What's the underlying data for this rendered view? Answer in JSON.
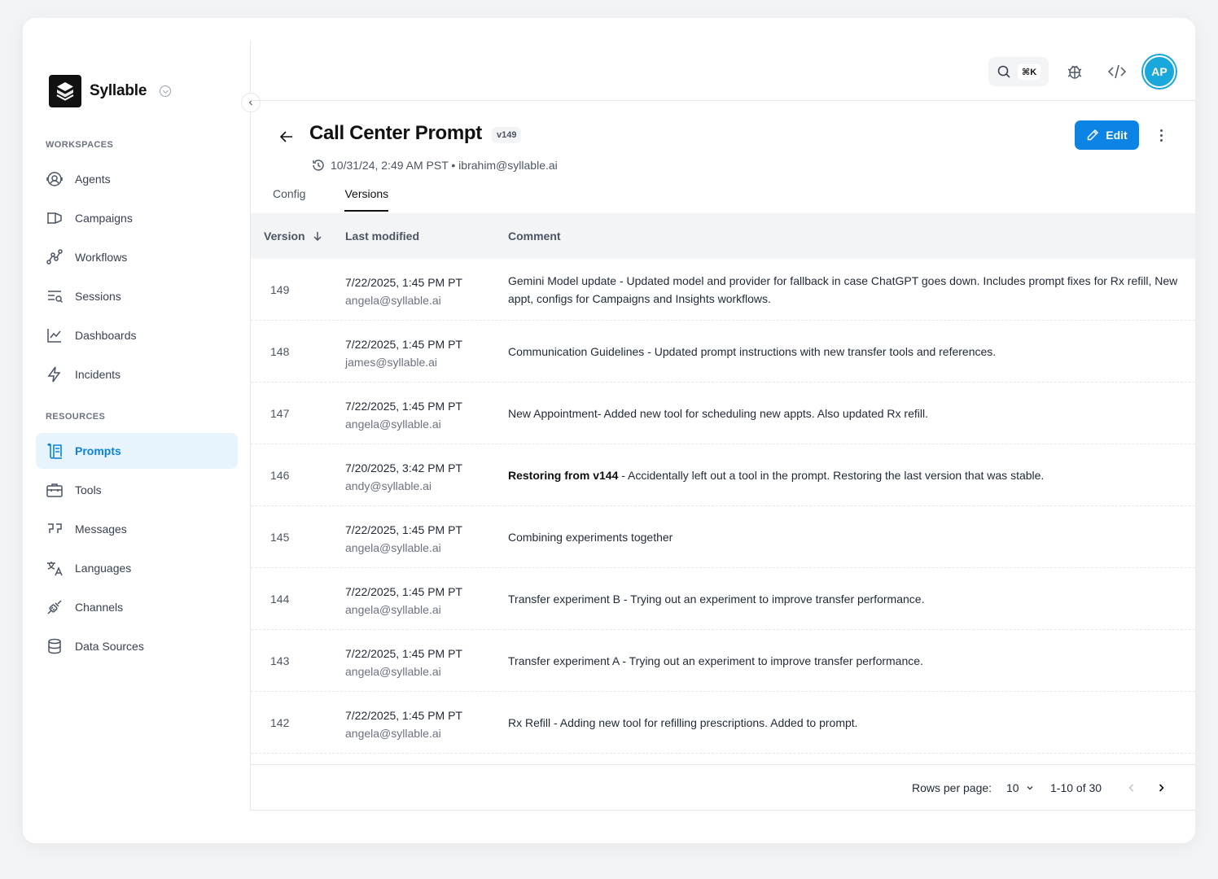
{
  "sidebar": {
    "brand_name": "Syllable",
    "workspaces_label": "WORKSPACES",
    "resources_label": "RESOURCES",
    "workspaces": [
      {
        "label": "Agents",
        "icon": "agents-icon"
      },
      {
        "label": "Campaigns",
        "icon": "megaphone-icon"
      },
      {
        "label": "Workflows",
        "icon": "workflow-icon"
      },
      {
        "label": "Sessions",
        "icon": "sessions-icon"
      },
      {
        "label": "Dashboards",
        "icon": "chart-icon"
      },
      {
        "label": "Incidents",
        "icon": "bolt-icon"
      }
    ],
    "resources": [
      {
        "label": "Prompts",
        "icon": "scroll-icon",
        "active": true
      },
      {
        "label": "Tools",
        "icon": "toolbox-icon"
      },
      {
        "label": "Messages",
        "icon": "quote-icon"
      },
      {
        "label": "Languages",
        "icon": "translate-icon"
      },
      {
        "label": "Channels",
        "icon": "plug-icon"
      },
      {
        "label": "Data Sources",
        "icon": "database-icon"
      }
    ]
  },
  "topbar": {
    "search_shortcut": "⌘K",
    "avatar_initials": "AP"
  },
  "header": {
    "title": "Call Center Prompt",
    "version": "v149",
    "meta": "10/31/24, 2:49 AM PST • ibrahim@syllable.ai",
    "edit_label": "Edit"
  },
  "tabs": [
    {
      "label": "Config",
      "active": false
    },
    {
      "label": "Versions",
      "active": true
    }
  ],
  "table": {
    "columns": {
      "version": "Version",
      "modified": "Last modified",
      "comment": "Comment"
    },
    "rows": [
      {
        "version": "149",
        "date": "7/22/2025, 1:45 PM PT",
        "email": "angela@syllable.ai",
        "comment_bold": "",
        "comment": "Gemini Model update - Updated model and provider for fallback in case ChatGPT goes down. Includes prompt fixes for Rx refill, New appt, configs for Campaigns and Insights workflows."
      },
      {
        "version": "148",
        "date": "7/22/2025, 1:45 PM PT",
        "email": "james@syllable.ai",
        "comment_bold": "",
        "comment": "Communication Guidelines - Updated prompt instructions with new transfer tools and references."
      },
      {
        "version": "147",
        "date": "7/22/2025, 1:45 PM PT",
        "email": "angela@syllable.ai",
        "comment_bold": "",
        "comment": "New Appointment- Added new tool for scheduling new appts. Also updated Rx refill."
      },
      {
        "version": "146",
        "date": "7/20/2025, 3:42 PM PT",
        "email": "andy@syllable.ai",
        "comment_bold": "Restoring from v144 ",
        "comment": "- Accidentally left out a tool in the prompt. Restoring the last version that was stable."
      },
      {
        "version": "145",
        "date": "7/22/2025, 1:45 PM PT",
        "email": "angela@syllable.ai",
        "comment_bold": "",
        "comment": "Combining experiments together"
      },
      {
        "version": "144",
        "date": "7/22/2025, 1:45 PM PT",
        "email": "angela@syllable.ai",
        "comment_bold": "",
        "comment": "Transfer experiment B - Trying out an experiment to improve transfer performance."
      },
      {
        "version": "143",
        "date": "7/22/2025, 1:45 PM PT",
        "email": "angela@syllable.ai",
        "comment_bold": "",
        "comment": "Transfer experiment A - Trying out an experiment to improve transfer performance."
      },
      {
        "version": "142",
        "date": "7/22/2025, 1:45 PM PT",
        "email": "angela@syllable.ai",
        "comment_bold": "",
        "comment": "Rx Refill - Adding new tool for refilling prescriptions. Added to prompt."
      }
    ]
  },
  "pagination": {
    "rows_per_page_label": "Rows per page:",
    "rows_per_page": "10",
    "range": "1-10 of 30"
  },
  "colors": {
    "accent": "#0b84e6",
    "active_nav_bg": "#e8f4fd",
    "avatar": "#1aa7dc"
  }
}
